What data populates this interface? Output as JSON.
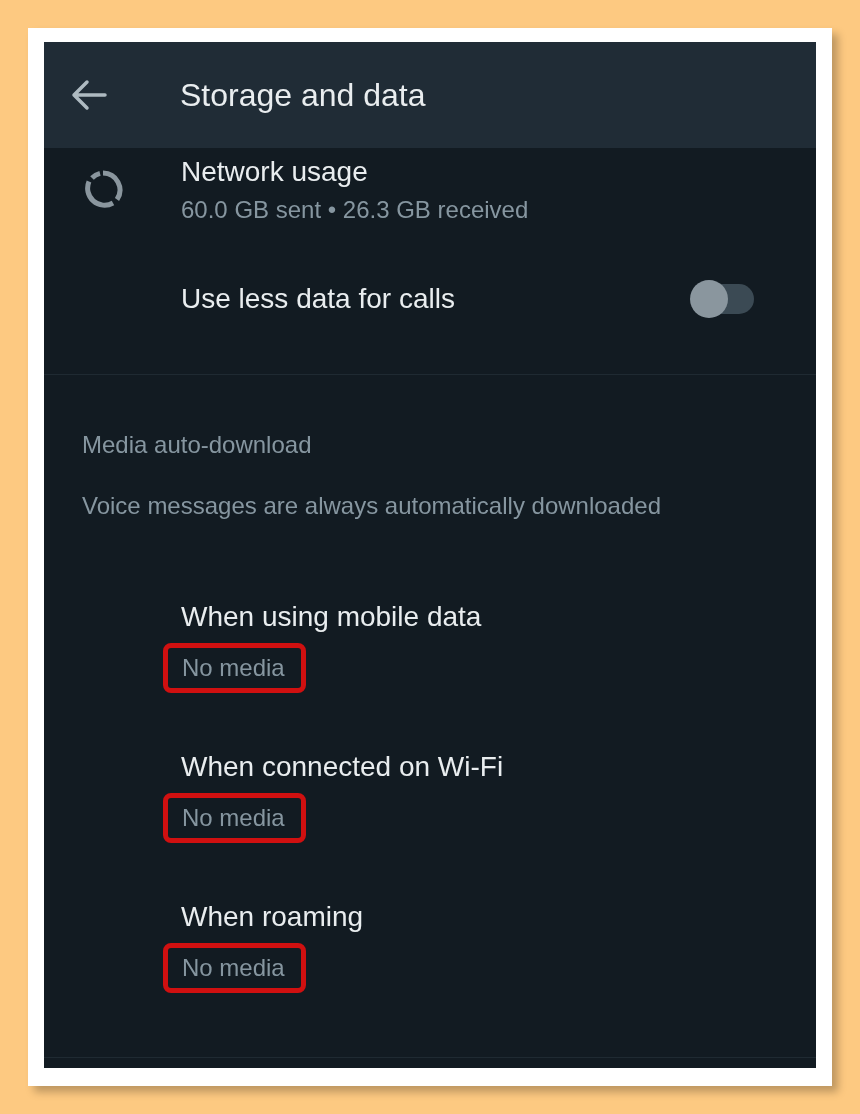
{
  "app_bar": {
    "title": "Storage and data"
  },
  "network_usage": {
    "title": "Network usage",
    "subtitle": "60.0 GB sent • 26.3 GB received"
  },
  "less_data_for_calls": {
    "label": "Use less data for calls",
    "on": false
  },
  "media_auto_download": {
    "heading": "Media auto-download",
    "note": "Voice messages are always automatically downloaded",
    "options": [
      {
        "title": "When using mobile data",
        "value": "No media",
        "highlighted": true
      },
      {
        "title": "When connected on Wi-Fi",
        "value": "No media",
        "highlighted": true
      },
      {
        "title": "When roaming",
        "value": "No media",
        "highlighted": true
      }
    ]
  }
}
